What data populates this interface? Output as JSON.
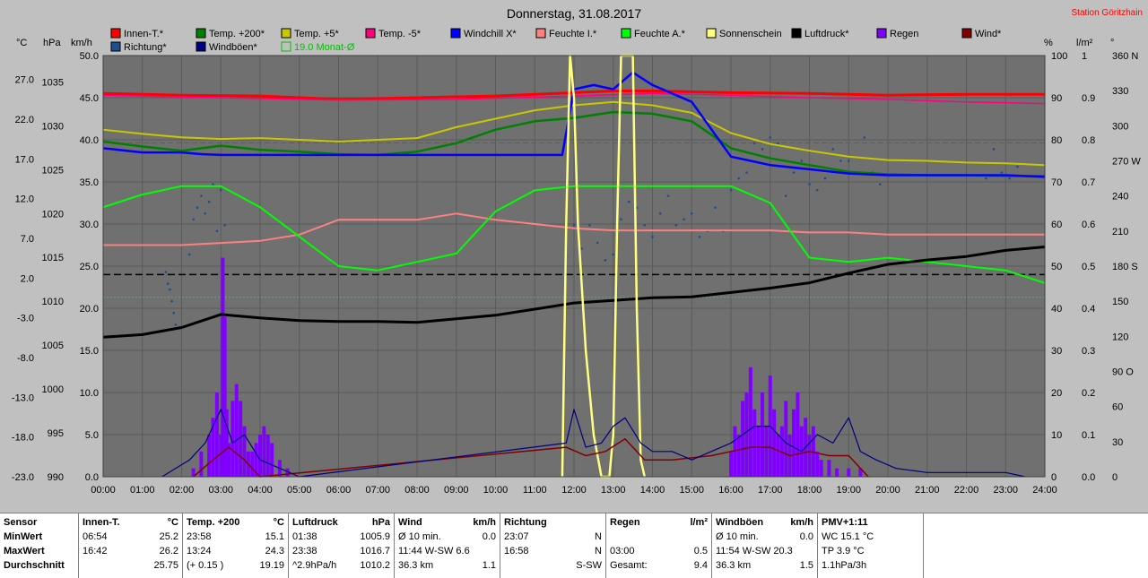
{
  "title": "Donnerstag, 31.08.2017",
  "station": "Station Göritzhain",
  "unit_labels": {
    "celsius": "°C",
    "hpa": "hPa",
    "kmh": "km/h",
    "percent": "%",
    "lqm": "l/m²",
    "deg": "°"
  },
  "legend": [
    {
      "label": "Innen-T.*",
      "color": "#ff0000"
    },
    {
      "label": "Temp. +200*",
      "color": "#008000"
    },
    {
      "label": "Temp. +5*",
      "color": "#c8c800"
    },
    {
      "label": "Temp. -5*",
      "color": "#ff0080"
    },
    {
      "label": "Windchill X*",
      "color": "#0000ff"
    },
    {
      "label": "Feuchte I.*",
      "color": "#ff8080"
    },
    {
      "label": "Feuchte A.*",
      "color": "#00ff00"
    },
    {
      "label": "Sonnenschein",
      "color": "#ffff80"
    },
    {
      "label": "Luftdruck*",
      "color": "#000000"
    },
    {
      "label": "Regen",
      "color": "#8000ff"
    },
    {
      "label": "Wind*",
      "color": "#800000"
    },
    {
      "label": "Richtung*",
      "color": "#1f4e8c"
    },
    {
      "label": "Windböen*",
      "color": "#000080"
    },
    {
      "label": "19.0 Monat-Ø",
      "color": "#00c000"
    }
  ],
  "chart_data": {
    "type": "line",
    "title": "Donnerstag, 31.08.2017",
    "x_ticks": [
      "00:00",
      "01:00",
      "02:00",
      "03:00",
      "04:00",
      "05:00",
      "06:00",
      "07:00",
      "08:00",
      "09:00",
      "10:00",
      "11:00",
      "12:00",
      "13:00",
      "14:00",
      "15:00",
      "16:00",
      "17:00",
      "18:00",
      "19:00",
      "20:00",
      "21:00",
      "22:00",
      "23:00",
      "24:00"
    ],
    "axes": {
      "celsius": {
        "ticks": [
          "27.0",
          "22.0",
          "17.0",
          "12.0",
          "7.0",
          "2.0",
          "-3.0",
          "-8.0",
          "-13.0",
          "-18.0",
          "-23.0"
        ],
        "range": [
          -23,
          30
        ]
      },
      "hpa": {
        "ticks": [
          "1035",
          "1030",
          "1025",
          "1020",
          "1015",
          "1010",
          "1005",
          "1000",
          "995",
          "990"
        ],
        "range": [
          990,
          1038
        ]
      },
      "kmh": {
        "ticks": [
          "50.0",
          "45.0",
          "40.0",
          "35.0",
          "30.0",
          "25.0",
          "20.0",
          "15.0",
          "10.0",
          "5.0",
          "0.0"
        ],
        "range": [
          0,
          50
        ]
      },
      "percent": {
        "ticks": [
          "100",
          "90",
          "80",
          "70",
          "60",
          "50",
          "40",
          "30",
          "20",
          "10",
          "0"
        ],
        "range": [
          0,
          100
        ]
      },
      "lqm": {
        "ticks": [
          "1",
          "0.9",
          "0.8",
          "0.7",
          "0.6",
          "0.5",
          "0.4",
          "0.3",
          "0.2",
          "0.1",
          "0.0"
        ],
        "range": [
          0,
          1
        ]
      },
      "deg": {
        "ticks": [
          "360 N",
          "330",
          "300",
          "270 W",
          "240",
          "210",
          "180 S",
          "150",
          "120",
          "90 O",
          "60",
          "30",
          "0"
        ],
        "range": [
          0,
          360
        ]
      }
    },
    "series": [
      {
        "name": "Innen-T.*",
        "color": "#ff0000",
        "width": 3,
        "axis": "kmh",
        "x": [
          0,
          2,
          4,
          6,
          8,
          10,
          12,
          13,
          14,
          16,
          18,
          20,
          22,
          24
        ],
        "y": [
          45.5,
          45.3,
          45.2,
          44.8,
          45,
          45.2,
          45.6,
          45.8,
          45.8,
          45.6,
          45.5,
          45.3,
          45.4,
          45.4
        ]
      },
      {
        "name": "Temp. -5*",
        "color": "#ff0080",
        "width": 1.5,
        "axis": "kmh",
        "x": [
          0,
          3,
          6,
          9,
          12,
          14,
          16,
          18,
          20,
          22,
          24
        ],
        "y": [
          45.3,
          45,
          44.7,
          44.8,
          45.2,
          45.5,
          45.3,
          45,
          44.8,
          44.5,
          44.3
        ]
      },
      {
        "name": "Temp. +5*",
        "color": "#c8c800",
        "width": 2,
        "axis": "kmh",
        "x": [
          0,
          1,
          2,
          3,
          4,
          6,
          8,
          9,
          10,
          11,
          12,
          13,
          14,
          15,
          16,
          17,
          18,
          19,
          20,
          21,
          22,
          23,
          24
        ],
        "y": [
          41.2,
          40.7,
          40.3,
          40.1,
          40.2,
          39.8,
          40.2,
          41.5,
          42.5,
          43.5,
          44.1,
          44.5,
          44.1,
          43.2,
          40.8,
          39.5,
          38.7,
          38,
          37.6,
          37.5,
          37.3,
          37.2,
          37
        ]
      },
      {
        "name": "Temp. +200*",
        "color": "#008000",
        "width": 2.5,
        "axis": "kmh",
        "x": [
          0,
          1,
          2,
          3,
          4,
          5,
          6,
          7,
          8,
          9,
          10,
          11,
          12,
          13,
          14,
          15,
          16,
          17,
          18,
          19,
          20,
          21,
          22,
          23,
          24
        ],
        "y": [
          39.8,
          39.2,
          38.7,
          39.3,
          38.8,
          38.6,
          38.3,
          38.2,
          38.6,
          39.6,
          41.2,
          42.2,
          42.6,
          43.3,
          43.1,
          42.2,
          39,
          37.8,
          37,
          36.2,
          35.9,
          35.8,
          35.8,
          35.7,
          35.7
        ]
      },
      {
        "name": "Windchill X*",
        "color": "#0000ff",
        "width": 2.5,
        "axis": "kmh",
        "x": [
          0,
          1,
          2,
          2.5,
          3,
          4,
          5,
          6,
          7,
          8,
          9,
          10,
          11,
          11.7,
          12,
          12.5,
          13,
          13.5,
          14,
          15,
          16,
          16.5,
          17,
          18,
          19,
          20,
          21,
          22,
          23,
          24
        ],
        "y": [
          39,
          38.5,
          38.5,
          38.3,
          38.2,
          38.2,
          38.2,
          38.2,
          38.2,
          38.2,
          38.2,
          38.2,
          38.2,
          38.2,
          46,
          46.5,
          46,
          48,
          46.5,
          44.5,
          38,
          37.5,
          37,
          36.5,
          36,
          35.8,
          35.8,
          35.8,
          35.8,
          35.6
        ]
      },
      {
        "name": "Feuchte I.*",
        "color": "#ff8080",
        "width": 2,
        "axis": "percent",
        "x": [
          0,
          1,
          2,
          3,
          4,
          5,
          6,
          7,
          8,
          9,
          10,
          11,
          12,
          13,
          14,
          15,
          16,
          17,
          18,
          19,
          20,
          21,
          22,
          23,
          24
        ],
        "y": [
          55,
          55,
          55,
          55.5,
          56,
          57.5,
          61,
          61,
          61,
          62.5,
          61,
          60,
          59,
          58.5,
          58.5,
          58.5,
          58.5,
          58.5,
          58,
          58,
          57.5,
          57.5,
          57.5,
          57.5,
          57.5
        ]
      },
      {
        "name": "Feuchte A.*",
        "color": "#00ff00",
        "width": 2,
        "axis": "percent",
        "x": [
          0,
          1,
          2,
          3,
          4,
          5,
          6,
          7,
          8,
          9,
          10,
          11,
          12,
          13,
          14,
          15,
          16,
          17,
          18,
          19,
          20,
          21,
          22,
          23,
          24
        ],
        "y": [
          64,
          67,
          69,
          69,
          64,
          57,
          50,
          49,
          51,
          53,
          63,
          68,
          69,
          69,
          69,
          69,
          69,
          65,
          52,
          51,
          52,
          51,
          50,
          49,
          46
        ]
      },
      {
        "name": "Luftdruck*",
        "color": "#000000",
        "width": 3,
        "axis": "hpa",
        "x": [
          0,
          1,
          2,
          3,
          4,
          5,
          6,
          7,
          8,
          9,
          10,
          11,
          12,
          13,
          14,
          15,
          16,
          17,
          18,
          19,
          20,
          21,
          22,
          23,
          24
        ],
        "y": [
          1005.9,
          1006.2,
          1007,
          1008.5,
          1008.1,
          1007.8,
          1007.7,
          1007.7,
          1007.6,
          1008,
          1008.4,
          1009.1,
          1009.8,
          1010.1,
          1010.4,
          1010.5,
          1011,
          1011.5,
          1012.1,
          1013.2,
          1014.2,
          1014.7,
          1015.1,
          1015.8,
          1016.2
        ]
      },
      {
        "name": "Sonnenschein",
        "color": "#ffff80",
        "width": 2.5,
        "axis": "kmh",
        "x": [
          11.7,
          11.8,
          11.9,
          12.0,
          12.1,
          12.3,
          12.5,
          12.7,
          12.8,
          12.9,
          13.0,
          13.1,
          13.2,
          13.3,
          13.5,
          13.6,
          13.7,
          13.8
        ],
        "y": [
          0,
          30,
          50,
          45,
          30,
          15,
          5,
          0,
          0,
          0,
          5,
          30,
          50,
          50,
          50,
          20,
          2,
          0
        ]
      },
      {
        "name": "Wind*",
        "color": "#800000",
        "width": 1.5,
        "axis": "kmh",
        "x": [
          2.3,
          2.8,
          3.2,
          3.6,
          4,
          11.8,
          12.3,
          12.8,
          13.3,
          13.8,
          14.5,
          15.5,
          16,
          16.5,
          17,
          17.5,
          18,
          18.5,
          19,
          19.5
        ],
        "y": [
          0,
          2,
          3.5,
          2,
          0,
          3.5,
          2.5,
          3,
          4.5,
          2,
          2,
          2.5,
          3,
          3.5,
          3.5,
          2.5,
          3,
          2.5,
          2.5,
          0
        ]
      },
      {
        "name": "Windböen*",
        "color": "#000080",
        "width": 1.2,
        "axis": "kmh",
        "x": [
          1.5,
          2.2,
          2.6,
          3,
          3.3,
          3.6,
          4,
          4.5,
          5,
          11.8,
          12,
          12.3,
          12.7,
          13,
          13.3,
          13.7,
          14,
          14.5,
          15,
          15.5,
          16,
          16.3,
          16.6,
          17,
          17.4,
          17.8,
          18.2,
          18.6,
          19,
          19.3,
          19.7,
          20.2,
          21,
          22,
          23,
          23.5
        ],
        "y": [
          0,
          2,
          4,
          8,
          4,
          5,
          2,
          1,
          0,
          4,
          8,
          3.5,
          4,
          6,
          7,
          4,
          3,
          3,
          2,
          3,
          4,
          5,
          6,
          6,
          4,
          3,
          5,
          4,
          7,
          3,
          2,
          1,
          0.5,
          0.5,
          0.5,
          0
        ]
      }
    ],
    "monat_avg": {
      "label": "19.0 Monat-Ø",
      "value_celsius": 19.0
    },
    "dashed_black_kmh": 24.0,
    "cyan_ref_kmh": 21.3,
    "regen_bars": {
      "color": "#8000ff",
      "axis": "kmh",
      "x": [
        2.3,
        2.5,
        2.7,
        2.8,
        2.9,
        3.0,
        3.05,
        3.1,
        3.15,
        3.2,
        3.3,
        3.4,
        3.5,
        3.6,
        3.7,
        3.8,
        3.9,
        4.0,
        4.1,
        4.2,
        4.3,
        4.5,
        4.7,
        16.0,
        16.1,
        16.2,
        16.3,
        16.4,
        16.5,
        16.6,
        16.7,
        16.8,
        16.9,
        17.0,
        17.1,
        17.2,
        17.3,
        17.4,
        17.5,
        17.6,
        17.7,
        17.8,
        17.9,
        18.0,
        18.1,
        18.2,
        18.3,
        18.5,
        18.7,
        19.0,
        19.3
      ],
      "y": [
        1,
        3,
        5,
        7,
        10,
        5,
        26,
        19,
        8,
        4,
        9,
        11,
        9,
        6,
        3,
        3,
        4,
        5,
        6,
        5,
        4,
        2,
        1,
        3,
        6,
        5,
        9,
        10,
        13,
        8,
        6,
        10,
        6,
        12,
        8,
        5,
        6,
        9,
        5,
        8,
        10,
        6,
        7,
        5,
        6,
        3,
        2,
        2,
        1,
        1,
        1
      ]
    },
    "richtung_points": {
      "color": "#1f4e8c",
      "axis": "deg",
      "x": [
        1.6,
        1.65,
        1.7,
        1.75,
        1.8,
        1.85,
        2.2,
        2.3,
        2.4,
        2.5,
        2.6,
        2.7,
        2.8,
        2.9,
        3.0,
        3.1,
        12.0,
        12.2,
        12.4,
        12.6,
        12.8,
        13.0,
        13.2,
        13.4,
        13.6,
        13.8,
        14.0,
        14.2,
        14.4,
        14.6,
        14.8,
        15.0,
        15.2,
        15.4,
        15.6,
        15.8,
        16.0,
        16.2,
        16.4,
        16.6,
        16.8,
        17.0,
        17.2,
        17.4,
        17.6,
        17.8,
        18.0,
        18.2,
        18.4,
        18.6,
        18.8,
        19.0,
        19.2,
        19.4,
        19.6,
        19.8,
        22.5,
        22.7,
        22.9,
        23.1,
        23.3
      ],
      "y": [
        175,
        165,
        160,
        150,
        140,
        130,
        190,
        220,
        230,
        240,
        225,
        235,
        250,
        210,
        245,
        215,
        215,
        195,
        215,
        200,
        185,
        190,
        220,
        235,
        230,
        215,
        205,
        225,
        240,
        215,
        220,
        225,
        205,
        210,
        230,
        210,
        245,
        255,
        260,
        285,
        280,
        290,
        285,
        240,
        260,
        270,
        250,
        245,
        255,
        280,
        270,
        270,
        260,
        290,
        260,
        250,
        255,
        280,
        260,
        255,
        265
      ]
    },
    "sensor_header": {
      "dot_color": "#000000"
    }
  },
  "summary": {
    "rows": [
      "Sensor",
      "MinWert",
      "MaxWert",
      "Durchschnitt"
    ],
    "cols": [
      {
        "header": [
          "Innen-T.",
          "°C"
        ],
        "cells": [
          [
            "06:54",
            "25.2"
          ],
          [
            "16:42",
            "26.2"
          ],
          [
            "",
            "25.75"
          ]
        ]
      },
      {
        "header": [
          "Temp. +200",
          "°C"
        ],
        "cells": [
          [
            "23:58",
            "15.1"
          ],
          [
            "13:24",
            "24.3"
          ],
          [
            "(+ 0.15 )",
            "19.19"
          ]
        ]
      },
      {
        "header": [
          "Luftdruck",
          "hPa"
        ],
        "cells": [
          [
            "01:38",
            "1005.9"
          ],
          [
            "23:38",
            "1016.7"
          ],
          [
            "^2.9hPa/h",
            "1010.2"
          ]
        ]
      },
      {
        "header": [
          "Wind",
          "km/h"
        ],
        "cells": [
          [
            "Ø 10 min.",
            "0.0"
          ],
          [
            "11:44     W-SW 6.6",
            ""
          ],
          [
            "36.3 km",
            "1.1"
          ]
        ]
      },
      {
        "header": [
          "Richtung",
          ""
        ],
        "cells": [
          [
            "23:07",
            "N"
          ],
          [
            "16:58",
            "N"
          ],
          [
            "",
            "S-SW"
          ]
        ]
      },
      {
        "header": [
          "Regen",
          "l/m²"
        ],
        "cells": [
          [
            "",
            ""
          ],
          [
            "03:00",
            "0.5"
          ],
          [
            "Gesamt:",
            "9.4"
          ]
        ]
      },
      {
        "header": [
          "Windböen",
          "km/h"
        ],
        "cells": [
          [
            "Ø 10 min.",
            "0.0"
          ],
          [
            "11:54     W-SW 20.3",
            ""
          ],
          [
            "36.3 km",
            "1.5"
          ]
        ]
      },
      {
        "header": [
          "PMV+1:11",
          ""
        ],
        "cells": [
          [
            "WC 15.1 °C",
            ""
          ],
          [
            "TP 3.9 °C",
            ""
          ],
          [
            "1.1hPa/3h",
            ""
          ]
        ]
      }
    ]
  }
}
